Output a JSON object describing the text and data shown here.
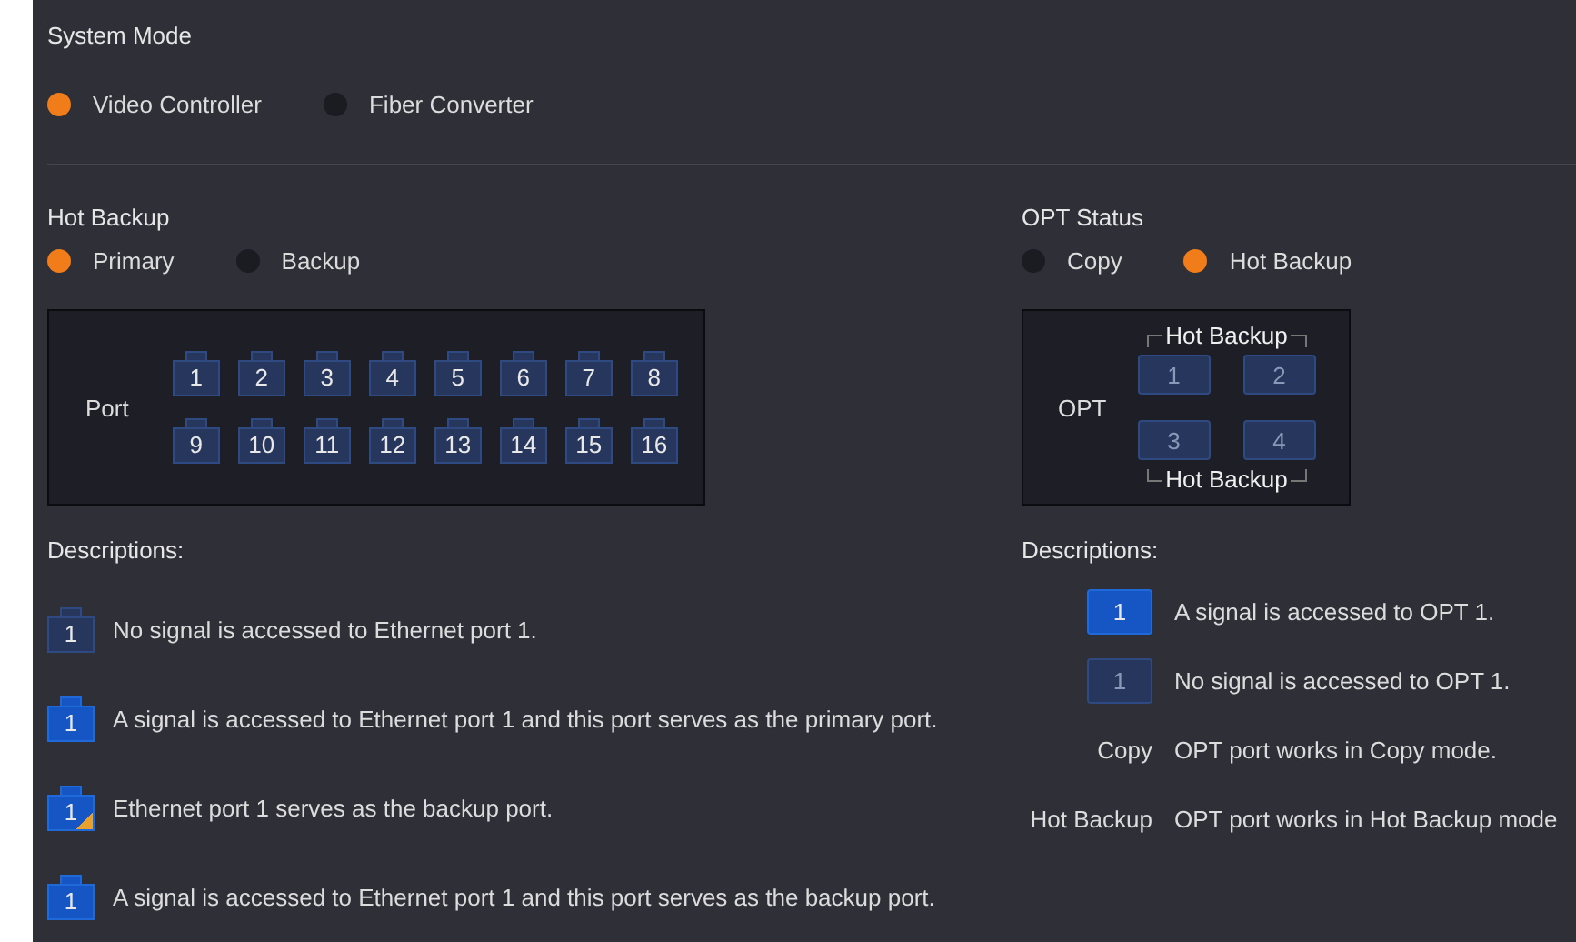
{
  "system_mode": {
    "title": "System Mode",
    "options": [
      {
        "label": "Video Controller",
        "selected": true
      },
      {
        "label": "Fiber Converter",
        "selected": false
      }
    ]
  },
  "hot_backup": {
    "title": "Hot Backup",
    "options": [
      {
        "label": "Primary",
        "selected": true
      },
      {
        "label": "Backup",
        "selected": false
      }
    ],
    "port_label": "Port",
    "ports": [
      {
        "label": "1",
        "signal": false
      },
      {
        "label": "2",
        "signal": false
      },
      {
        "label": "3",
        "signal": false
      },
      {
        "label": "4",
        "signal": false
      },
      {
        "label": "5",
        "signal": false
      },
      {
        "label": "6",
        "signal": false
      },
      {
        "label": "7",
        "signal": false
      },
      {
        "label": "8",
        "signal": false
      },
      {
        "label": "9",
        "signal": false
      },
      {
        "label": "10",
        "signal": false
      },
      {
        "label": "11",
        "signal": false
      },
      {
        "label": "12",
        "signal": false
      },
      {
        "label": "13",
        "signal": false
      },
      {
        "label": "14",
        "signal": false
      },
      {
        "label": "15",
        "signal": false
      },
      {
        "label": "16",
        "signal": false
      }
    ],
    "descriptions_title": "Descriptions:",
    "descriptions": [
      {
        "label": "1",
        "signal": false,
        "backup_mark": false,
        "text": "No signal is accessed to Ethernet port 1."
      },
      {
        "label": "1",
        "signal": true,
        "backup_mark": false,
        "text": "A signal is accessed to Ethernet port 1 and this port serves as the primary port."
      },
      {
        "label": "1",
        "signal": true,
        "backup_mark": true,
        "text": "Ethernet port 1 serves as the backup port."
      },
      {
        "label": "1",
        "signal": true,
        "backup_mark": false,
        "text": "A signal is accessed to Ethernet port 1 and this port serves as the backup port."
      }
    ]
  },
  "opt_status": {
    "title": "OPT Status",
    "options": [
      {
        "label": "Copy",
        "selected": false
      },
      {
        "label": "Hot Backup",
        "selected": true
      }
    ],
    "opt_label": "OPT",
    "top_bracket": "Hot Backup",
    "opts": [
      {
        "label": "1",
        "signal": false
      },
      {
        "label": "2",
        "signal": false
      },
      {
        "label": "3",
        "signal": false
      },
      {
        "label": "4",
        "signal": false
      }
    ],
    "bottom_bracket": "Hot Backup",
    "descriptions_title": "Descriptions:",
    "descriptions": [
      {
        "kind": "port",
        "label": "1",
        "signal": true,
        "text": "A signal is accessed to OPT 1."
      },
      {
        "kind": "port",
        "label": "1",
        "signal": false,
        "text": "No signal is accessed to OPT 1."
      },
      {
        "kind": "mode",
        "label": "Copy",
        "text": "OPT port works in Copy mode."
      },
      {
        "kind": "mode",
        "label": "Hot Backup",
        "text": "OPT port works in Hot Backup mode"
      }
    ]
  }
}
